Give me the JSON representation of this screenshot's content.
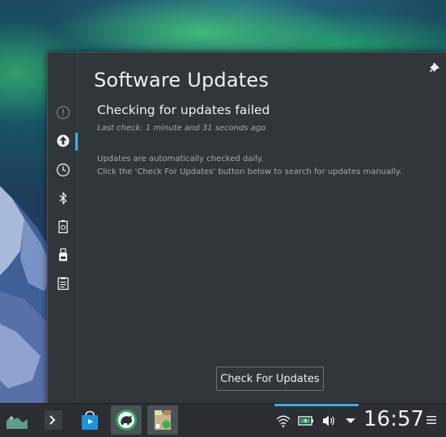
{
  "popup": {
    "title": "Software Updates",
    "status": "Checking for updates failed",
    "last_check": "Last check: 1 minute and 31 seconds ago",
    "info_line1": "Updates are automatically checked daily.",
    "info_line2": "Click the 'Check For Updates' button below to search for updates manually.",
    "check_button": "Check For Updates"
  },
  "side_rail": {
    "icons": [
      "notifications-icon",
      "software-updates-icon",
      "clock-icon",
      "bluetooth-icon",
      "battery-device-icon",
      "usb-device-icon",
      "clipboard-icon"
    ],
    "active": "software-updates-icon"
  },
  "taskbar": {
    "items": [
      "application-launcher",
      "konsole",
      "discover-store",
      "dolphin-file-manager",
      "package-installer"
    ],
    "active": [
      "dolphin-file-manager",
      "package-installer"
    ]
  },
  "tray": {
    "icons": [
      "wifi-icon",
      "battery-icon",
      "volume-icon",
      "expand-tray-arrow-icon"
    ],
    "clock": "16:57"
  },
  "colors": {
    "accent": "#3daee9",
    "popup_bg": "#31363b",
    "panel_bg": "#2b2f33",
    "text": "#eff0f1",
    "muted_text": "#a6a9ac"
  }
}
